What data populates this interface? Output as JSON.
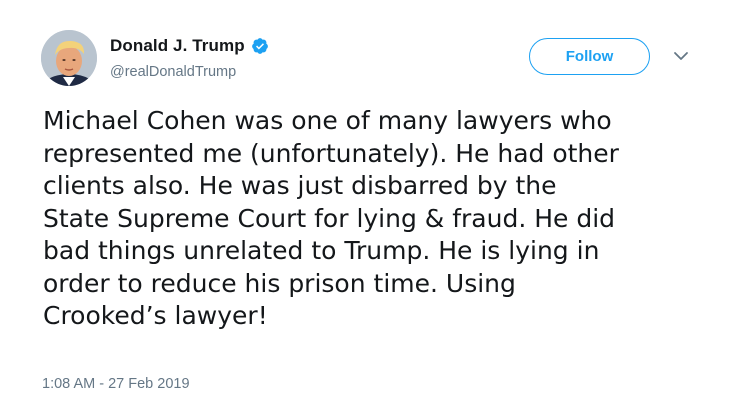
{
  "user": {
    "display_name": "Donald J. Trump",
    "handle": "@realDonaldTrump",
    "verified": true
  },
  "actions": {
    "follow_label": "Follow"
  },
  "tweet": {
    "lines": [
      "Michael Cohen was one of many lawyers who",
      "represented me (unfortunately). He had other",
      "clients also. He was just disbarred by the",
      "State Supreme Court for lying & fraud. He did",
      "bad things unrelated to Trump. He is lying in",
      "order to reduce his prison time. Using",
      "Crooked’s lawyer!"
    ],
    "timestamp": "1:08 AM - 27 Feb 2019"
  },
  "colors": {
    "accent": "#1da1f2",
    "text": "#14171a",
    "secondary": "#657786"
  },
  "icons": {
    "verified": "verified-badge-icon",
    "more": "chevron-down-icon",
    "avatar": "profile-photo"
  }
}
